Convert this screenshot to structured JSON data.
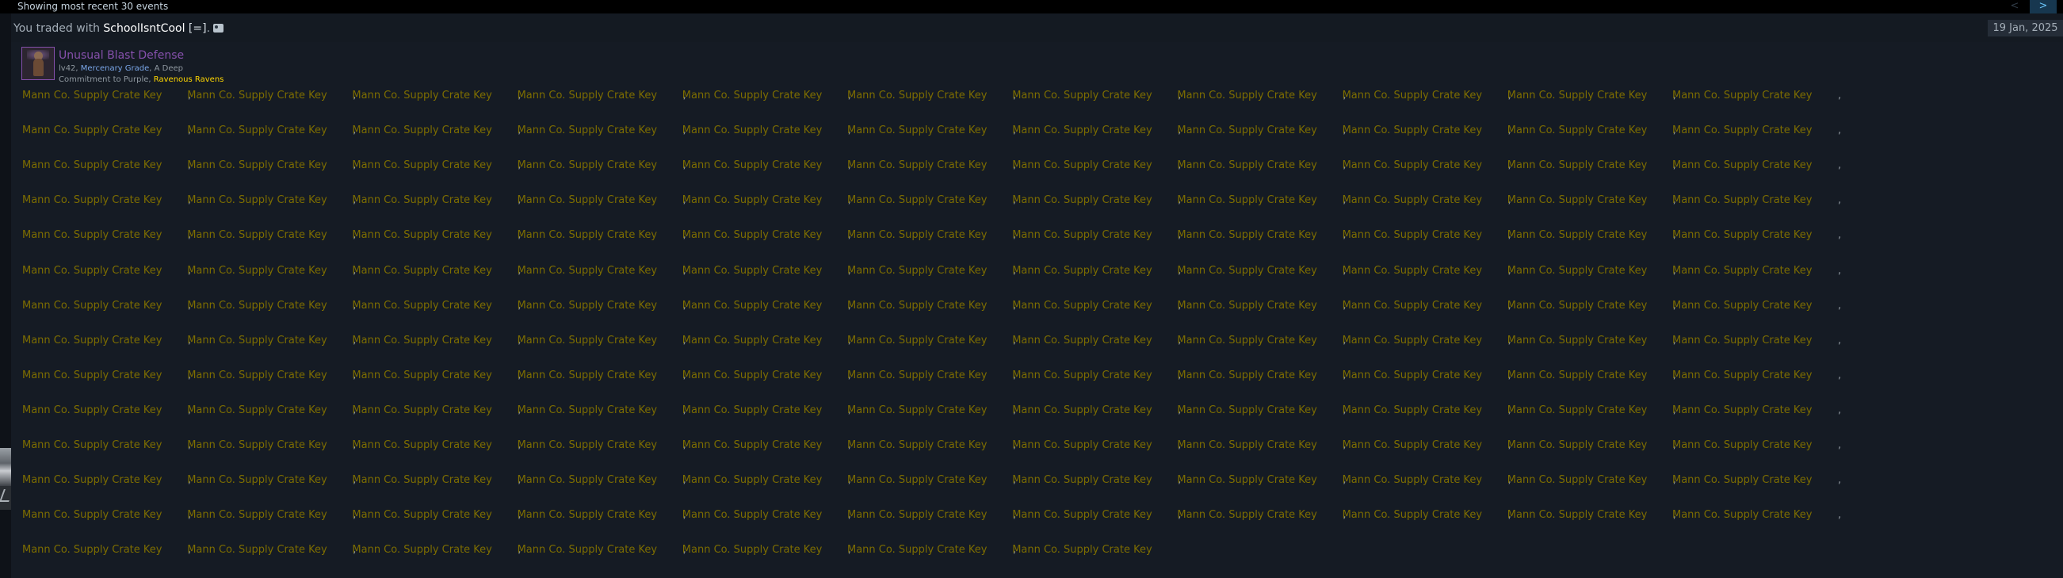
{
  "header": {
    "showing_label": "Showing most recent 30 events",
    "prev_label": "<",
    "next_label": ">"
  },
  "event": {
    "prefix": "You traded with ",
    "partner_name": "SchoolIsntCool",
    "partner_tag": " [=]",
    "suffix": ".",
    "date": "19 Jan, 2025"
  },
  "item": {
    "name": "Unusual Blast Defense",
    "desc_level": "lv42, ",
    "desc_grade": "Mercenary Grade",
    "desc_rest": ", A Deep",
    "desc_line2": "Commitment to Purple, ",
    "desc_paint": "Ravenous Ravens"
  },
  "keys": {
    "label": "Mann Co. Supply Crate Key",
    "separator": ",",
    "count": 150,
    "per_row": 11
  },
  "colors": {
    "background": "#151b24",
    "unusual_purple": "#8650ac",
    "key_text": "#7d6d00",
    "link_blue": "#66c0f4"
  }
}
